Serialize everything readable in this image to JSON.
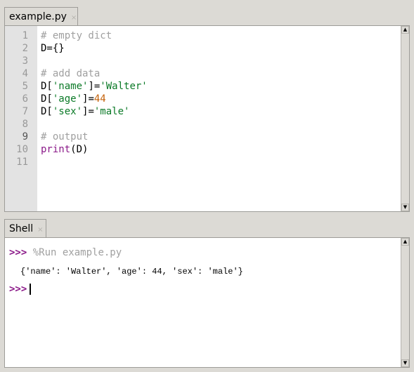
{
  "editor": {
    "tab_label": "example.py",
    "close_glyph": "×",
    "lines": [
      {
        "n": "1",
        "tokens": [
          {
            "t": "# empty dict",
            "c": "cm"
          }
        ]
      },
      {
        "n": "2",
        "tokens": [
          {
            "t": "D={}",
            "c": ""
          }
        ]
      },
      {
        "n": "3",
        "tokens": []
      },
      {
        "n": "4",
        "tokens": [
          {
            "t": "# add data",
            "c": "cm"
          }
        ]
      },
      {
        "n": "5",
        "tokens": [
          {
            "t": "D[",
            "c": ""
          },
          {
            "t": "'name'",
            "c": "str"
          },
          {
            "t": "]=",
            "c": ""
          },
          {
            "t": "'Walter'",
            "c": "str"
          }
        ]
      },
      {
        "n": "6",
        "tokens": [
          {
            "t": "D[",
            "c": ""
          },
          {
            "t": "'age'",
            "c": "str"
          },
          {
            "t": "]=",
            "c": ""
          },
          {
            "t": "44",
            "c": "num"
          }
        ]
      },
      {
        "n": "7",
        "tokens": [
          {
            "t": "D[",
            "c": ""
          },
          {
            "t": "'sex'",
            "c": "str"
          },
          {
            "t": "]=",
            "c": ""
          },
          {
            "t": "'male'",
            "c": "str"
          }
        ]
      },
      {
        "n": "8",
        "tokens": []
      },
      {
        "n": "9",
        "current": true,
        "tokens": [
          {
            "t": "# output",
            "c": "cm"
          }
        ]
      },
      {
        "n": "10",
        "tokens": [
          {
            "t": "print",
            "c": "kw"
          },
          {
            "t": "(D)",
            "c": ""
          }
        ]
      },
      {
        "n": "11",
        "tokens": []
      }
    ]
  },
  "shell": {
    "tab_label": "Shell",
    "close_glyph": "×",
    "prompt": ">>>",
    "command": "%Run example.py",
    "output": "{'name': 'Walter', 'age': 44, 'sex': 'male'}",
    "input_value": ""
  },
  "icons": {
    "scroll_up": "▲",
    "scroll_down": "▼"
  }
}
